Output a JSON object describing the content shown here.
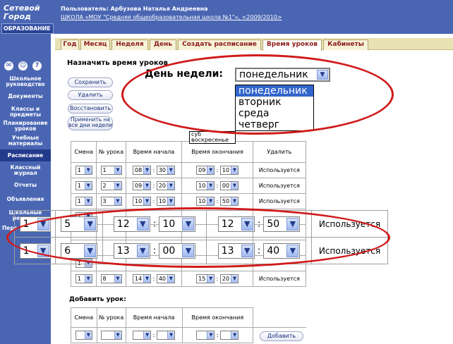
{
  "logo": {
    "line1": "Сетевой",
    "line2": "Город",
    "line3": "ОБРАЗОВАНИЕ"
  },
  "header": {
    "user": "Пользователь: Арбузова Наталья Андреевна",
    "school": "ШКОЛА «МОУ \"Средняя общеобразовательная школа №1\"», <2009/2010>"
  },
  "tabs": [
    "Год",
    "Месяц",
    "Неделя",
    "День",
    "Создать расписание",
    "Время уроков",
    "Кабинеты"
  ],
  "sidebar": {
    "icons": [
      "mail-icon",
      "users-icon",
      "help-icon"
    ],
    "items": [
      "Школьное руководство",
      "Документы",
      "Классы и предметы",
      "Планирование уроков",
      "Учебные материалы",
      "Расписание",
      "Классный журнал",
      "Отчеты",
      "Объявления",
      "Школьные ресурсы",
      "Перс"
    ]
  },
  "page": {
    "title": "Назначить время уроков",
    "buttons": {
      "save": "Сохранить",
      "delete": "Удалить",
      "restore": "Восстановить",
      "apply_all": "Применить на все дни недели"
    }
  },
  "dow": {
    "label": "День недели:",
    "value": "понедельник",
    "options": [
      "понедельник",
      "вторник",
      "среда",
      "четверг"
    ],
    "small_options": [
      "суб",
      "воскресенье"
    ]
  },
  "schedule": {
    "headers": [
      "Смена",
      "№ урока",
      "Время начала",
      "Время окончания",
      "Удалить"
    ],
    "rows": [
      {
        "shift": "1",
        "num": "1",
        "sh": "08",
        "sm": "30",
        "eh": "09",
        "em": "10",
        "status": "Используется"
      },
      {
        "shift": "1",
        "num": "2",
        "sh": "09",
        "sm": "20",
        "eh": "10",
        "em": "00",
        "status": "Используется"
      },
      {
        "shift": "1",
        "num": "3",
        "sh": "10",
        "sm": "10",
        "eh": "10",
        "em": "50",
        "status": "Используется"
      },
      {
        "shift": "1",
        "num": "",
        "sh": "",
        "sm": "",
        "eh": "",
        "em": "",
        "status": ""
      },
      {
        "shift": "",
        "num": "",
        "sh": "",
        "sm": "",
        "eh": "",
        "em": "",
        "status": ""
      },
      {
        "shift": "",
        "num": "",
        "sh": "",
        "sm": "",
        "eh": "",
        "em": "",
        "status": ""
      },
      {
        "shift": "1",
        "num": "",
        "sh": "",
        "sm": "",
        "eh": "",
        "em": "",
        "status": ""
      },
      {
        "shift": "1",
        "num": "8",
        "sh": "14",
        "sm": "40",
        "eh": "15",
        "em": "20",
        "status": "Используется"
      }
    ],
    "zoom_rows": [
      {
        "shift": "1",
        "num": "5",
        "sh": "12",
        "sm": "10",
        "eh": "12",
        "em": "50",
        "status": "Используется"
      },
      {
        "shift": "1",
        "num": "6",
        "sh": "13",
        "sm": "00",
        "eh": "13",
        "em": "40",
        "status": "Используется"
      }
    ]
  },
  "add": {
    "title": "Добавить урок:",
    "headers": [
      "Смена",
      "№ урока",
      "Время начала",
      "Время окончания"
    ],
    "button": "Добавить"
  },
  "colors": {
    "header_bg": "#4a66b3",
    "tab_text": "#8c1a1a",
    "highlight": "#d01a1a",
    "selected": "#3366cc"
  }
}
